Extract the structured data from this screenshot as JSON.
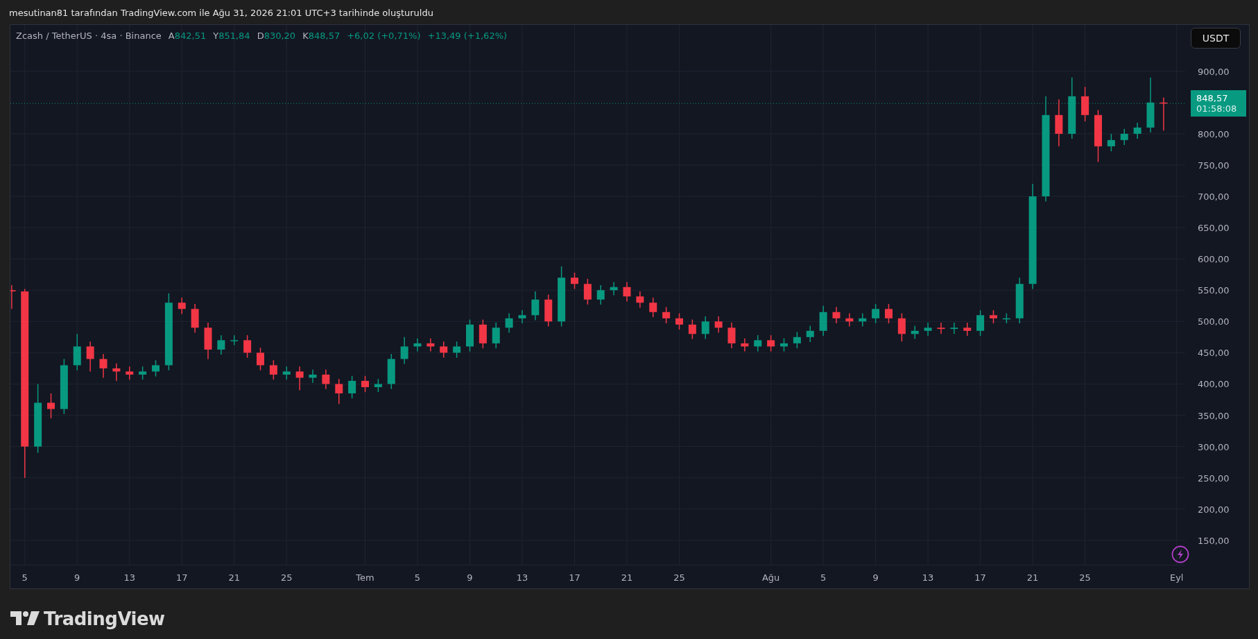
{
  "caption": "mesutinan81 tarafından TradingView.com ile Ağu 31, 2026 21:01 UTC+3 tarihinde oluşturuldu",
  "legend": {
    "symbol": "Zcash / TetherUS · 4sa · Binance",
    "ohlc": [
      {
        "label": "A",
        "value": "842,51"
      },
      {
        "label": "Y",
        "value": "851,84"
      },
      {
        "label": "D",
        "value": "830,20"
      },
      {
        "label": "K",
        "value": "848,57"
      }
    ],
    "changes": [
      "+6,02 (+0,71%)",
      "+13,49 (+1,62%)"
    ]
  },
  "currency_button": "USDT",
  "price_tag": {
    "countdown": "01:58:08"
  },
  "chart_data": {
    "type": "candlestick",
    "grid": true,
    "ylim": [
      111,
      974
    ],
    "categories": [
      null,
      "5",
      null,
      null,
      null,
      "9",
      null,
      null,
      null,
      "13",
      null,
      null,
      null,
      "17",
      null,
      null,
      null,
      "21",
      null,
      null,
      null,
      "25",
      null,
      null,
      null,
      null,
      null,
      "Tem",
      null,
      null,
      null,
      "5",
      null,
      null,
      null,
      "9",
      null,
      null,
      null,
      "13",
      null,
      null,
      null,
      "17",
      null,
      null,
      null,
      "21",
      null,
      null,
      null,
      "25",
      null,
      null,
      null,
      null,
      null,
      null,
      "Ağu",
      null,
      null,
      null,
      "5",
      null,
      null,
      null,
      "9",
      null,
      null,
      null,
      "13",
      null,
      null,
      null,
      "17",
      null,
      null,
      null,
      "21",
      null,
      null,
      null,
      "25",
      null,
      null,
      null,
      null,
      null,
      null,
      "Eyl"
    ],
    "ohlc": [
      [
        550,
        558,
        520,
        548
      ],
      [
        548,
        552,
        250,
        300
      ],
      [
        300,
        400,
        290,
        370
      ],
      [
        370,
        385,
        345,
        360
      ],
      [
        360,
        440,
        352,
        430
      ],
      [
        430,
        480,
        422,
        460
      ],
      [
        460,
        468,
        420,
        440
      ],
      [
        440,
        448,
        410,
        425
      ],
      [
        425,
        433,
        405,
        420
      ],
      [
        420,
        428,
        407,
        415
      ],
      [
        415,
        428,
        407,
        420
      ],
      [
        420,
        438,
        412,
        430
      ],
      [
        430,
        545,
        422,
        530
      ],
      [
        530,
        538,
        512,
        520
      ],
      [
        520,
        528,
        482,
        490
      ],
      [
        490,
        498,
        440,
        455
      ],
      [
        455,
        478,
        447,
        470
      ],
      [
        470,
        478,
        462,
        470
      ],
      [
        470,
        478,
        442,
        450
      ],
      [
        450,
        458,
        422,
        430
      ],
      [
        430,
        438,
        407,
        415
      ],
      [
        415,
        428,
        407,
        420
      ],
      [
        420,
        428,
        390,
        410
      ],
      [
        410,
        423,
        402,
        415
      ],
      [
        415,
        423,
        392,
        400
      ],
      [
        400,
        408,
        368,
        385
      ],
      [
        385,
        413,
        377,
        405
      ],
      [
        405,
        413,
        387,
        395
      ],
      [
        395,
        408,
        387,
        400
      ],
      [
        400,
        448,
        392,
        440
      ],
      [
        440,
        475,
        432,
        460
      ],
      [
        460,
        473,
        452,
        465
      ],
      [
        465,
        473,
        452,
        460
      ],
      [
        460,
        468,
        442,
        450
      ],
      [
        450,
        468,
        442,
        460
      ],
      [
        460,
        503,
        452,
        495
      ],
      [
        495,
        503,
        457,
        465
      ],
      [
        465,
        498,
        457,
        490
      ],
      [
        490,
        513,
        482,
        505
      ],
      [
        505,
        518,
        497,
        510
      ],
      [
        510,
        548,
        502,
        535
      ],
      [
        535,
        543,
        492,
        500
      ],
      [
        500,
        588,
        492,
        570
      ],
      [
        570,
        578,
        552,
        560
      ],
      [
        560,
        568,
        527,
        535
      ],
      [
        535,
        558,
        527,
        550
      ],
      [
        550,
        563,
        542,
        555
      ],
      [
        555,
        563,
        532,
        540
      ],
      [
        540,
        548,
        522,
        530
      ],
      [
        530,
        538,
        507,
        515
      ],
      [
        515,
        523,
        497,
        505
      ],
      [
        505,
        513,
        487,
        495
      ],
      [
        495,
        503,
        472,
        480
      ],
      [
        480,
        508,
        472,
        500
      ],
      [
        500,
        508,
        482,
        490
      ],
      [
        490,
        498,
        457,
        465
      ],
      [
        465,
        473,
        452,
        460
      ],
      [
        460,
        478,
        452,
        470
      ],
      [
        470,
        478,
        452,
        460
      ],
      [
        460,
        473,
        452,
        465
      ],
      [
        465,
        483,
        457,
        475
      ],
      [
        475,
        493,
        467,
        485
      ],
      [
        485,
        525,
        477,
        515
      ],
      [
        515,
        523,
        497,
        505
      ],
      [
        505,
        513,
        492,
        500
      ],
      [
        500,
        513,
        492,
        505
      ],
      [
        505,
        528,
        497,
        520
      ],
      [
        520,
        528,
        497,
        505
      ],
      [
        505,
        513,
        468,
        480
      ],
      [
        480,
        493,
        472,
        485
      ],
      [
        485,
        498,
        477,
        490
      ],
      [
        490,
        498,
        480,
        488
      ],
      [
        488,
        498,
        480,
        490
      ],
      [
        490,
        498,
        477,
        485
      ],
      [
        485,
        518,
        477,
        510
      ],
      [
        510,
        518,
        497,
        505
      ],
      [
        505,
        513,
        497,
        505
      ],
      [
        505,
        570,
        497,
        560
      ],
      [
        560,
        720,
        552,
        700
      ],
      [
        700,
        860,
        692,
        830
      ],
      [
        830,
        855,
        780,
        800
      ],
      [
        800,
        890,
        792,
        860
      ],
      [
        860,
        875,
        820,
        830
      ],
      [
        830,
        838,
        755,
        780
      ],
      [
        780,
        800,
        772,
        790
      ],
      [
        790,
        808,
        782,
        800
      ],
      [
        800,
        818,
        792,
        810
      ],
      [
        810,
        890,
        802,
        850
      ],
      [
        850,
        858,
        805,
        848.6
      ],
      null
    ],
    "ref_lines": [
      {
        "axis": "y",
        "value": 848.57,
        "label": "848,57",
        "color": "#089981"
      }
    ],
    "yticks": [
      {
        "value": 150,
        "label": "150,00"
      },
      {
        "value": 200,
        "label": "200,00"
      },
      {
        "value": 250,
        "label": "250,00"
      },
      {
        "value": 300,
        "label": "300,00"
      },
      {
        "value": 350,
        "label": "350,00"
      },
      {
        "value": 400,
        "label": "400,00"
      },
      {
        "value": 450,
        "label": "450,00"
      },
      {
        "value": 500,
        "label": "500,00"
      },
      {
        "value": 550,
        "label": "550,00"
      },
      {
        "value": 600,
        "label": "600,00"
      },
      {
        "value": 650,
        "label": "650,00"
      },
      {
        "value": 700,
        "label": "700,00"
      },
      {
        "value": 750,
        "label": "750,00"
      },
      {
        "value": 800,
        "label": "800,00"
      },
      {
        "value": 900,
        "label": "900,00"
      }
    ]
  },
  "brand": "TradingView"
}
